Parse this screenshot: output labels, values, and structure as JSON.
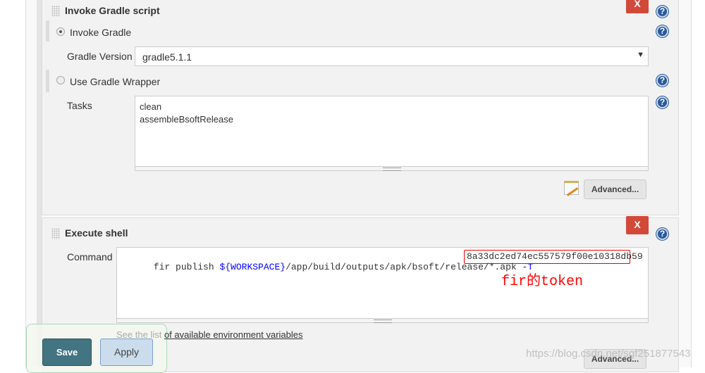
{
  "gradle": {
    "title": "Invoke Gradle script",
    "invoke_label": "Invoke Gradle",
    "version_label": "Gradle Version",
    "version_value": "gradle5.1.1",
    "wrapper_label": "Use Gradle Wrapper",
    "tasks_label": "Tasks",
    "tasks_lines": [
      "clean",
      "assembleBsoftRelease"
    ],
    "advanced": "Advanced...",
    "delete": "X"
  },
  "shell": {
    "title": "Execute shell",
    "command_label": "Command",
    "cmd_prefix": "fir publish ",
    "cmd_var": "${WORKSPACE}",
    "cmd_path": "/app/build/outputs/apk/bsoft/release/*.apk ",
    "cmd_flag": "-T",
    "token": "8a33dc2ed74ec557579f00e10318db59",
    "annotation": "fir的token",
    "env_prefix": "See the list ",
    "env_link": "of available environment variables",
    "advanced": "Advanced...",
    "delete": "X"
  },
  "footer": {
    "save": "Save",
    "apply": "Apply"
  },
  "watermark": "https://blog.csdn.net/sgf251877543",
  "colors": {
    "delete": "#d24939",
    "save": "#427482",
    "annotation": "#ff0000"
  }
}
